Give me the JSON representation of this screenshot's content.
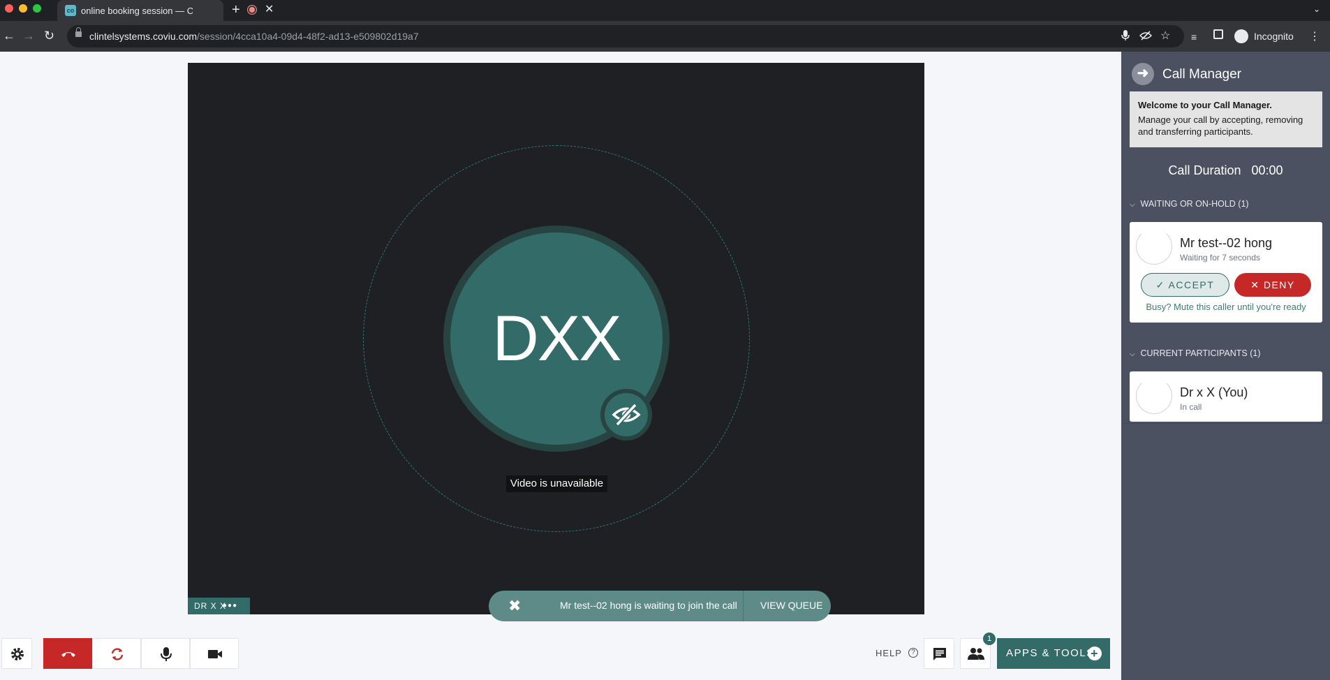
{
  "browser": {
    "tab_title": "online booking session — C",
    "tab_favicon": "co",
    "url_host": "clintelsystems.coviu.com",
    "url_path": "/session/4cca10a4-09d4-48f2-ad13-e509802d19a7",
    "profile_label": "Incognito"
  },
  "video": {
    "initials": "DXX",
    "unavailable_text": "Video is unavailable",
    "self_label": "DR X X",
    "self_menu": "●●●"
  },
  "toast": {
    "message": "Mr test--02 hong is waiting to join the call",
    "action": "VIEW QUEUE"
  },
  "controls": {
    "help_label": "HELP",
    "participants_badge": "1",
    "apps_label": "APPS & TOOLS"
  },
  "sidebar": {
    "title": "Call Manager",
    "welcome_title": "Welcome to your Call Manager.",
    "welcome_body": "Manage your call by accepting, removing and transferring participants.",
    "duration_label": "Call Duration",
    "duration_value": "00:00",
    "waiting_header": "WAITING OR ON-HOLD (1)",
    "waiting": {
      "name": "Mr test--02 hong",
      "status": "Waiting for 7 seconds",
      "accept_label": "ACCEPT",
      "deny_label": "DENY",
      "mute_text": "Busy? Mute this caller until you're ready"
    },
    "participants_header": "CURRENT PARTICIPANTS (1)",
    "participant": {
      "name": "Dr x X (You)",
      "status": "In call"
    }
  },
  "colors": {
    "accent": "#326b68",
    "danger": "#c62828",
    "sidebar_bg": "#4b5161"
  }
}
